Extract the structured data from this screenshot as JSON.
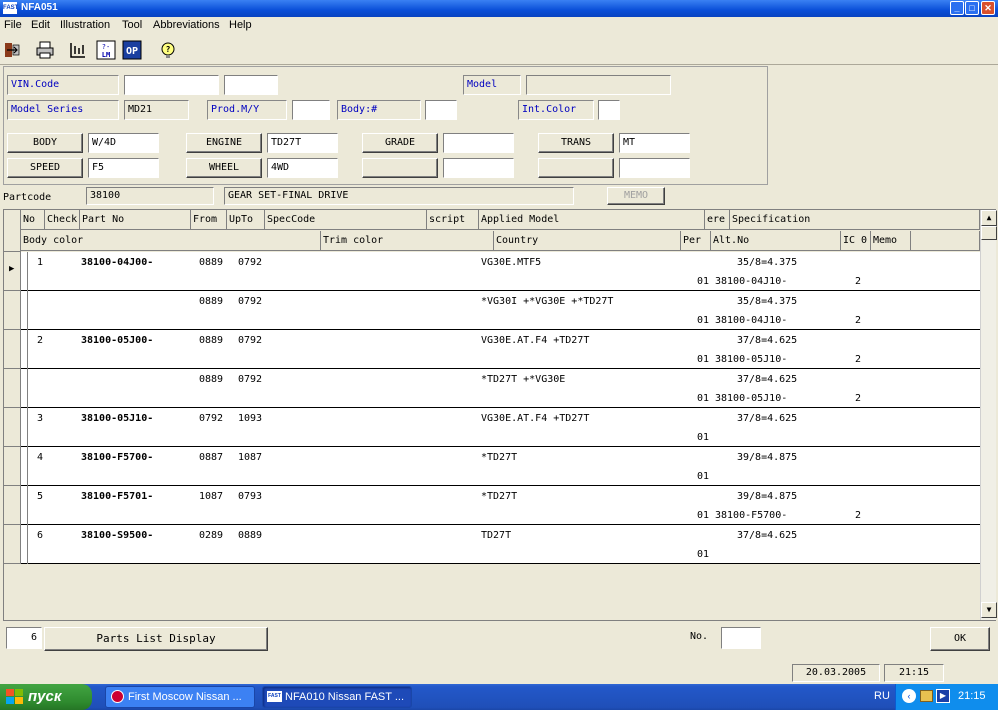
{
  "window": {
    "title": "NFA051",
    "app_badge": "FAST"
  },
  "menu": [
    "File",
    "Edit",
    "Illustration",
    "Tool",
    "Abbreviations",
    "Help"
  ],
  "form": {
    "vin_code_label": "VIN.Code",
    "vin_code_1": "",
    "vin_code_2": "",
    "model_label": "Model",
    "model_value": "",
    "model_series_label": "Model Series",
    "model_series_value": "MD21",
    "prod_label": "Prod.M/Y",
    "prod_value": "",
    "body_no_label": "Body:#",
    "body_no_value": "",
    "int_color_label": "Int.Color",
    "int_color_value": "",
    "body_btn": "BODY",
    "body_value": "W/4D",
    "engine_btn": "ENGINE",
    "engine_value": "TD27T",
    "grade_btn": "GRADE",
    "grade_value": "",
    "trans_btn": "TRANS",
    "trans_value": "MT",
    "speed_btn": "SPEED",
    "speed_value": "F5",
    "wheel_btn": "WHEEL",
    "wheel_value": "4WD",
    "extra_value_1": "",
    "extra_value_2": ""
  },
  "partcode": {
    "label": "Partcode",
    "code": "38100",
    "desc": "GEAR SET-FINAL DRIVE",
    "memo_btn": "MEMO"
  },
  "grid": {
    "headers1": [
      "No",
      "Check",
      "Part No",
      "From",
      "UpTo",
      "SpecCode",
      "script",
      "Applied Model",
      "ere",
      "Specification"
    ],
    "headers2": [
      "Body color",
      "Trim color",
      "Country",
      "Per",
      "Alt.No",
      "IC 0",
      "Memo"
    ],
    "rows": [
      {
        "no": "1",
        "part": "38100-04J00-",
        "from": "0889",
        "upto": "0792",
        "applied": "VG30E.MTF5",
        "spec": "35/8=4.375",
        "per": "01",
        "alt": "38100-04J10-",
        "ic": "2"
      },
      {
        "no": "",
        "part": "",
        "from": "0889",
        "upto": "0792",
        "applied": "*VG30I +*VG30E +*TD27T",
        "spec": "35/8=4.375",
        "per": "01",
        "alt": "38100-04J10-",
        "ic": "2"
      },
      {
        "no": "2",
        "part": "38100-05J00-",
        "from": "0889",
        "upto": "0792",
        "applied": "VG30E.AT.F4 +TD27T",
        "spec": "37/8=4.625",
        "per": "01",
        "alt": "38100-05J10-",
        "ic": "2"
      },
      {
        "no": "",
        "part": "",
        "from": "0889",
        "upto": "0792",
        "applied": "*TD27T +*VG30E",
        "spec": "37/8=4.625",
        "per": "01",
        "alt": "38100-05J10-",
        "ic": "2"
      },
      {
        "no": "3",
        "part": "38100-05J10-",
        "from": "0792",
        "upto": "1093",
        "applied": "VG30E.AT.F4 +TD27T",
        "spec": "37/8=4.625",
        "per": "01",
        "alt": "",
        "ic": ""
      },
      {
        "no": "4",
        "part": "38100-F5700-",
        "from": "0887",
        "upto": "1087",
        "applied": "*TD27T",
        "spec": "39/8=4.875",
        "per": "01",
        "alt": "",
        "ic": ""
      },
      {
        "no": "5",
        "part": "38100-F5701-",
        "from": "1087",
        "upto": "0793",
        "applied": "*TD27T",
        "spec": "39/8=4.875",
        "per": "01",
        "alt": "38100-F5700-",
        "ic": "2"
      },
      {
        "no": "6",
        "part": "38100-S9500-",
        "from": "0289",
        "upto": "0889",
        "applied": "TD27T",
        "spec": "37/8=4.625",
        "per": "01",
        "alt": "",
        "ic": ""
      }
    ]
  },
  "bottom": {
    "count": "6",
    "parts_list_btn": "Parts List Display",
    "no_label": "No.",
    "no_value": "",
    "ok_btn": "OK"
  },
  "status": {
    "date": "20.03.2005",
    "time": "21:15"
  },
  "taskbar": {
    "start": "пуск",
    "tasks": [
      "First Moscow Nissan ...",
      "NFA010 Nissan FAST ..."
    ],
    "lang": "RU",
    "clock": "21:15"
  }
}
